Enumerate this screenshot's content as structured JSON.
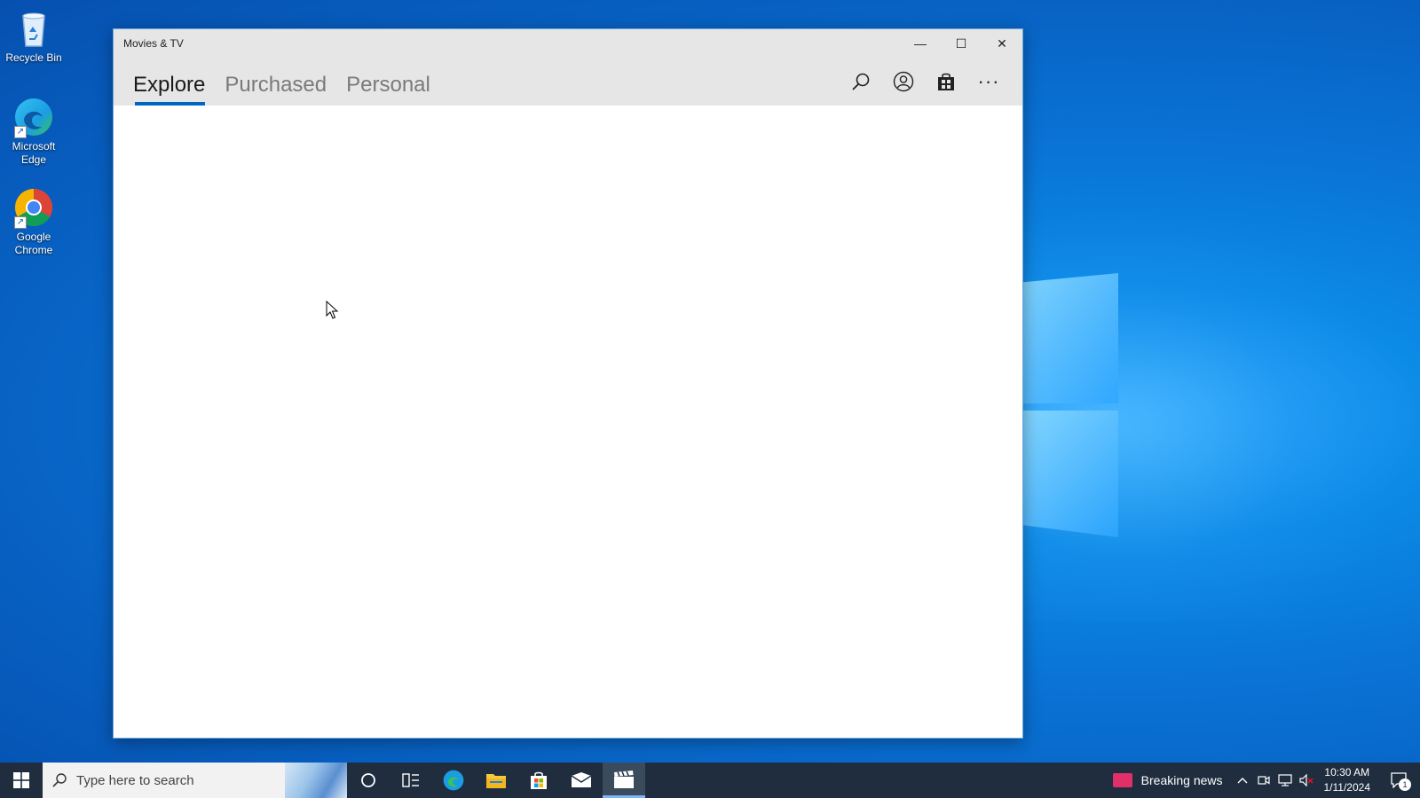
{
  "desktop": {
    "icons": [
      {
        "label": "Recycle Bin"
      },
      {
        "label": "Microsoft Edge"
      },
      {
        "label": "Google Chrome"
      }
    ]
  },
  "window": {
    "title": "Movies & TV",
    "controls": {
      "minimize": "—",
      "maximize": "☐",
      "close": "✕"
    },
    "tabs": [
      {
        "label": "Explore",
        "active": true
      },
      {
        "label": "Purchased",
        "active": false
      },
      {
        "label": "Personal",
        "active": false
      }
    ],
    "actions": {
      "search_icon": "search-icon",
      "account_icon": "account-icon",
      "store_icon": "store-bag-icon",
      "more_label": "···"
    }
  },
  "taskbar": {
    "search_placeholder": "Type here to search",
    "news_label": "Breaking news",
    "clock": {
      "time": "10:30 AM",
      "date": "1/11/2024"
    },
    "notification_count": "1",
    "accent": "#0067c0"
  }
}
